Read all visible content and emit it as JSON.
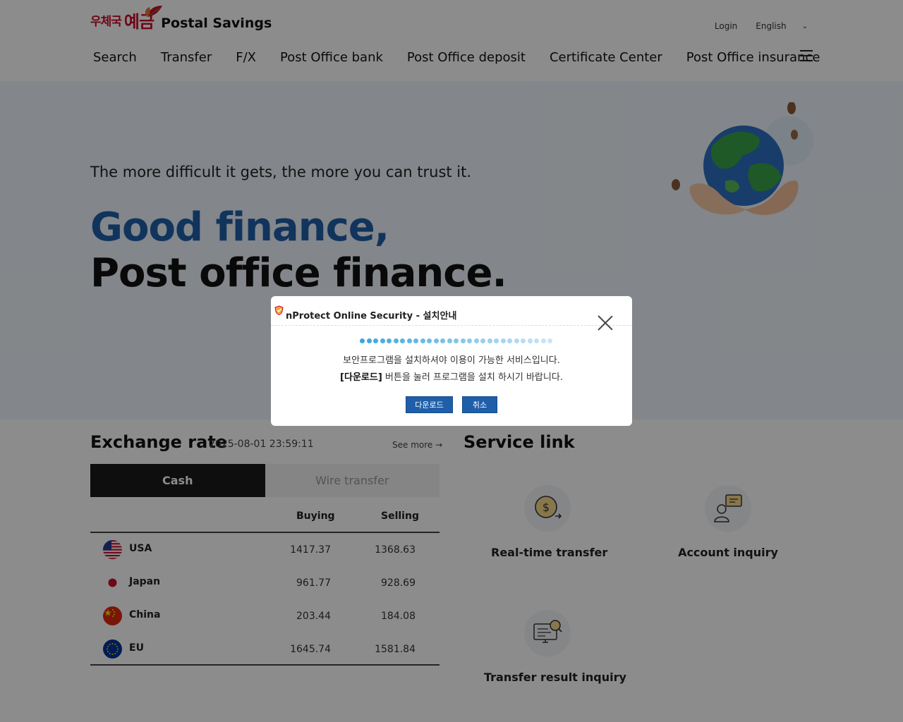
{
  "header": {
    "logo_kr_small": "우체국",
    "logo_kr_big": "예금",
    "logo_en": "Postal Savings",
    "login": "Login",
    "language": "English",
    "nav": [
      "Search",
      "Transfer",
      "F/X",
      "Post Office bank",
      "Post Office deposit",
      "Certificate Center",
      "Post Office insurance"
    ]
  },
  "hero": {
    "subtitle": "The more difficult it gets, the more you can trust it.",
    "headline1": "Good finance,",
    "headline2": "Post office finance."
  },
  "exchange": {
    "title": "Exchange rate",
    "date": "2025-08-01 23:59:11",
    "see_more": "See more",
    "tabs": [
      "Cash",
      "Wire transfer"
    ],
    "active_tab": "Cash",
    "columns": [
      "Buying",
      "Selling"
    ],
    "rows": [
      {
        "country": "USA",
        "buying": "1417.37",
        "selling": "1368.63",
        "flag": "us-flag"
      },
      {
        "country": "Japan",
        "buying": "961.77",
        "selling": "928.69",
        "flag": "japan-flag"
      },
      {
        "country": "China",
        "buying": "203.44",
        "selling": "184.08",
        "flag": "china-flag"
      },
      {
        "country": "EU",
        "buying": "1645.74",
        "selling": "1581.84",
        "flag": "eu-flag"
      }
    ]
  },
  "service": {
    "title": "Service link",
    "items": [
      {
        "label": "Real-time transfer",
        "icon": "coin-transfer-icon"
      },
      {
        "label": "Account inquiry",
        "icon": "person-chat-icon"
      },
      {
        "label": "Transfer result inquiry",
        "icon": "monitor-search-icon"
      }
    ]
  },
  "modal": {
    "title": "nProtect Online Security - 설치안내",
    "message1": "보안프로그램을 설치하셔야 이용이 가능한 서비스입니다.",
    "message2_bold": "[다운로드]",
    "message2_rest": " 버튼을 눌러 프로그램을 설치 하시기 바랍니다.",
    "download_button": "다운로드",
    "cancel_button": "취소",
    "progress_dots": 29,
    "colors": {
      "primary": "#1f5faa",
      "dot_dark": "#3aa6dc",
      "dot_light": "#c9e6f6"
    }
  }
}
